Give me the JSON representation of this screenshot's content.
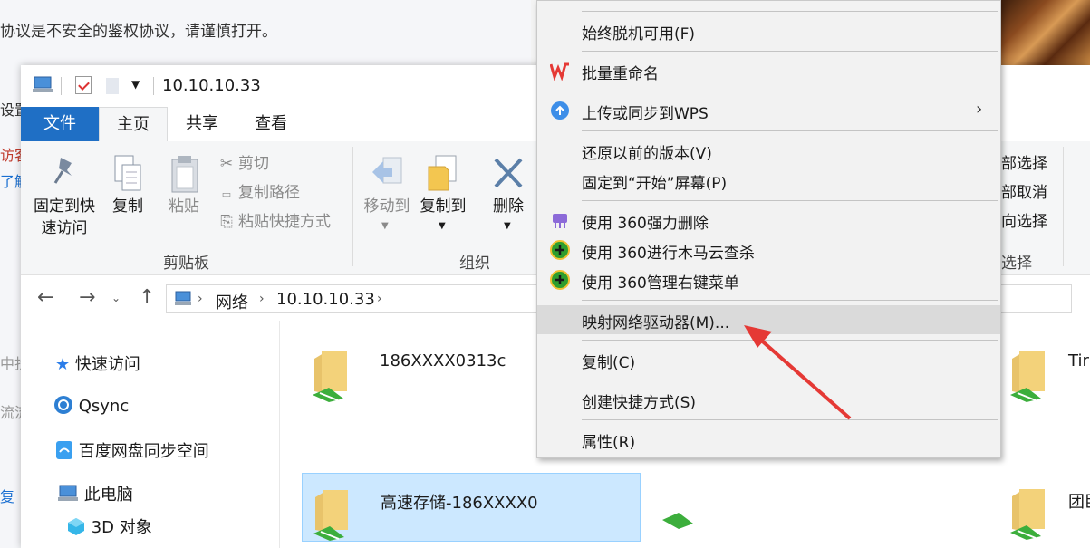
{
  "background": {
    "warning_text": "协议是不安全的鉴权协议，请谨慎打开。",
    "fragments": [
      "设置",
      "访客",
      "了解",
      "中找",
      "流流",
      "复"
    ]
  },
  "window": {
    "title": "10.10.10.33",
    "tabs": [
      "文件",
      "主页",
      "共享",
      "查看"
    ],
    "ribbon": {
      "pin_label_line1": "固定到快",
      "pin_label_line2": "速访问",
      "copy_label": "复制",
      "paste_label": "粘贴",
      "cut_label": "剪切",
      "copy_path_label": "复制路径",
      "paste_shortcut_label": "粘贴快捷方式",
      "clipboard_group": "剪贴板",
      "move_to_label": "移动到",
      "copy_to_label": "复制到",
      "delete_label": "删除",
      "organize_group": "组织",
      "select_all_frag": "部选择",
      "select_none_frag": "部取消",
      "invert_frag": "向选择",
      "select_group_frag": "选择"
    },
    "address": {
      "crumbs": [
        "网络",
        "10.10.10.33"
      ]
    },
    "nav": {
      "quick_access": "快速访问",
      "qsync": "Qsync",
      "baidu": "百度网盘同步空间",
      "this_pc": "此电脑",
      "objects_3d": "3D 对象"
    },
    "items": [
      {
        "name": "186XXXX0313c"
      },
      {
        "name": "高速存储-186XXXX0"
      },
      {
        "name": "Tir"
      },
      {
        "name": "团臣"
      }
    ]
  },
  "context_menu": {
    "items": {
      "offline": "始终脱机可用(F)",
      "batch_rename": "批量重命名",
      "upload_wps": "上传或同步到WPS",
      "restore": "还原以前的版本(V)",
      "pin_start": "固定到“开始”屏幕(P)",
      "del_360": "使用 360强力删除",
      "scan_360": "使用 360进行木马云查杀",
      "manage_360": "使用 360管理右键菜单",
      "map_drive": "映射网络驱动器(M)...",
      "copy": "复制(C)",
      "shortcut": "创建快捷方式(S)",
      "properties": "属性(R)"
    }
  },
  "colors": {
    "accent": "#1f6fc5",
    "selection": "#cce8ff",
    "highlight": "#dadada",
    "arrow": "#e53935",
    "wps_red": "#e53935",
    "cloud_blue": "#3d8ee8",
    "green_360": "#2e9e2e"
  }
}
